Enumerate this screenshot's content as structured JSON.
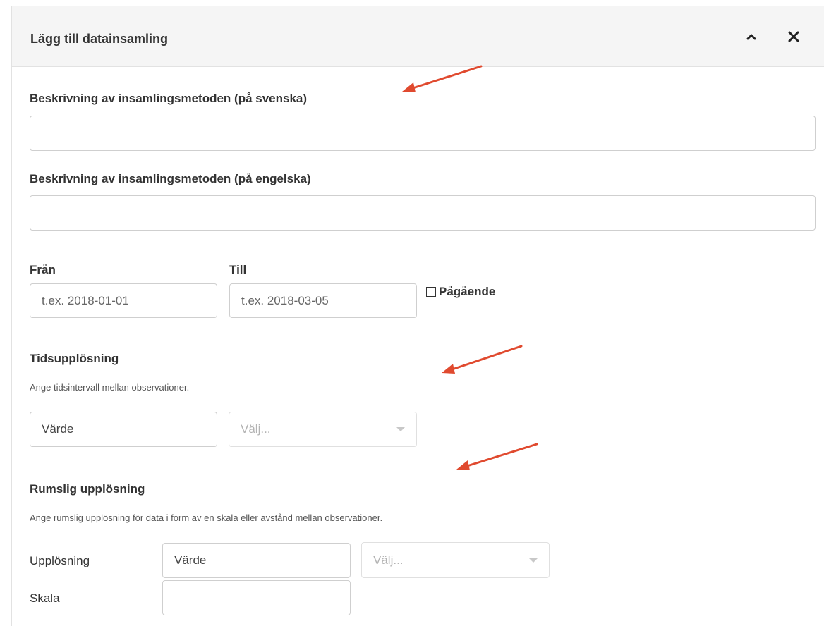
{
  "panel": {
    "title": "Lägg till datainsamling",
    "collapse_icon": "chevron-up-icon",
    "close_icon": "close-icon"
  },
  "description_sv": {
    "label": "Beskrivning av insamlingsmetoden (på svenska)",
    "value": "",
    "placeholder": ""
  },
  "description_en": {
    "label": "Beskrivning av insamlingsmetoden (på engelska)",
    "value": "",
    "placeholder": ""
  },
  "period": {
    "from_label": "Från",
    "from_placeholder": "t.ex. 2018-01-01",
    "to_label": "Till",
    "to_placeholder": "t.ex. 2018-03-05",
    "ongoing_label": "Pågående",
    "ongoing_checked": false
  },
  "time_resolution": {
    "heading": "Tidsupplösning",
    "help": "Ange tidsintervall mellan observationer.",
    "value_placeholder": "Värde",
    "unit_placeholder": "Välj..."
  },
  "spatial_resolution": {
    "heading": "Rumslig upplösning",
    "help": "Ange rumslig upplösning för data i form av en skala eller avstånd mellan observationer.",
    "resolution_label": "Upplösning",
    "resolution_placeholder": "Värde",
    "resolution_unit_placeholder": "Välj...",
    "scale_label": "Skala",
    "scale_value": ""
  },
  "annotations": {
    "arrow_color": "#e04a2f"
  }
}
